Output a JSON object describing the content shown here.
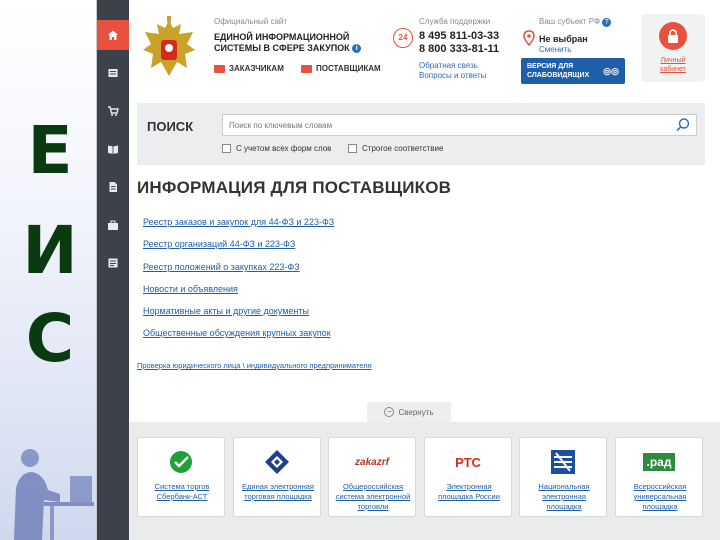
{
  "slide": {
    "letters": [
      "Е",
      "И",
      "С"
    ]
  },
  "sidebar": {
    "icons": [
      "home-icon",
      "list-icon",
      "cart-icon",
      "book-icon",
      "document-icon",
      "briefcase-icon",
      "news-icon"
    ]
  },
  "header": {
    "official_site": "Официальный сайт",
    "system_name_1": "ЕДИНОЙ ИНФОРМАЦИОННОЙ",
    "system_name_2": "СИСТЕМЫ В СФЕРЕ ЗАКУПОК",
    "customers": "ЗАКАЗЧИКАМ",
    "suppliers": "ПОСТАВЩИКАМ",
    "support_title": "Служба поддержки",
    "support_badge": "24",
    "phone_1": "8 495 811-03-33",
    "phone_2": "8 800 333-81-11",
    "feedback": "Обратная связь",
    "faq": "Вопросы и ответы",
    "region_title": "Ваш субъект РФ",
    "region_value": "Не выбран",
    "region_change": "Сменить",
    "vision_1": "ВЕРСИЯ ДЛЯ",
    "vision_2": "СЛАБОВИДЯЩИХ",
    "cabinet_1": "Личный",
    "cabinet_2": "кабинет"
  },
  "search": {
    "title": "ПОИСК",
    "placeholder": "Поиск по ключевым словам",
    "option_all_forms": "С учетом всех форм слов",
    "option_strict": "Строгое соответствие"
  },
  "main": {
    "title": "ИНФОРМАЦИЯ ДЛЯ ПОСТАВЩИКОВ",
    "links": [
      "Реестр заказов и закупок для 44-ФЗ и 223-ФЗ",
      "Реестр организаций 44-ФЗ и 223-ФЗ",
      "Реестр положений о закупках 223-ФЗ",
      "Новости и объявления",
      "Нормативные акты и другие документы",
      "Общественные обсуждения крупных закупок"
    ],
    "check_link": "Проверка юридического лица \\ индивидуального предпринимателя",
    "collapse": "Свернуть"
  },
  "platforms": [
    {
      "lines": [
        "Система торгов",
        "Сбербанк-АСТ"
      ],
      "logo_text": ""
    },
    {
      "lines": [
        "Единая электронная",
        "торговая площадка"
      ],
      "logo_text": ""
    },
    {
      "lines": [
        "Общероссийская",
        "система электронной",
        "торговли"
      ],
      "logo_text": "zakazrf"
    },
    {
      "lines": [
        "Электронная",
        "площадка России"
      ],
      "logo_text": "РТС"
    },
    {
      "lines": [
        "Национальная",
        "электронная",
        "площадка"
      ],
      "logo_text": ""
    },
    {
      "lines": [
        "Всероссийская",
        "универсальная",
        "площадка"
      ],
      "logo_text": ".рад"
    }
  ],
  "colors": {
    "accent": "#e8513e",
    "link": "#1f5ea8",
    "sidebar": "#3b4249",
    "letters": "#0a3a10"
  }
}
